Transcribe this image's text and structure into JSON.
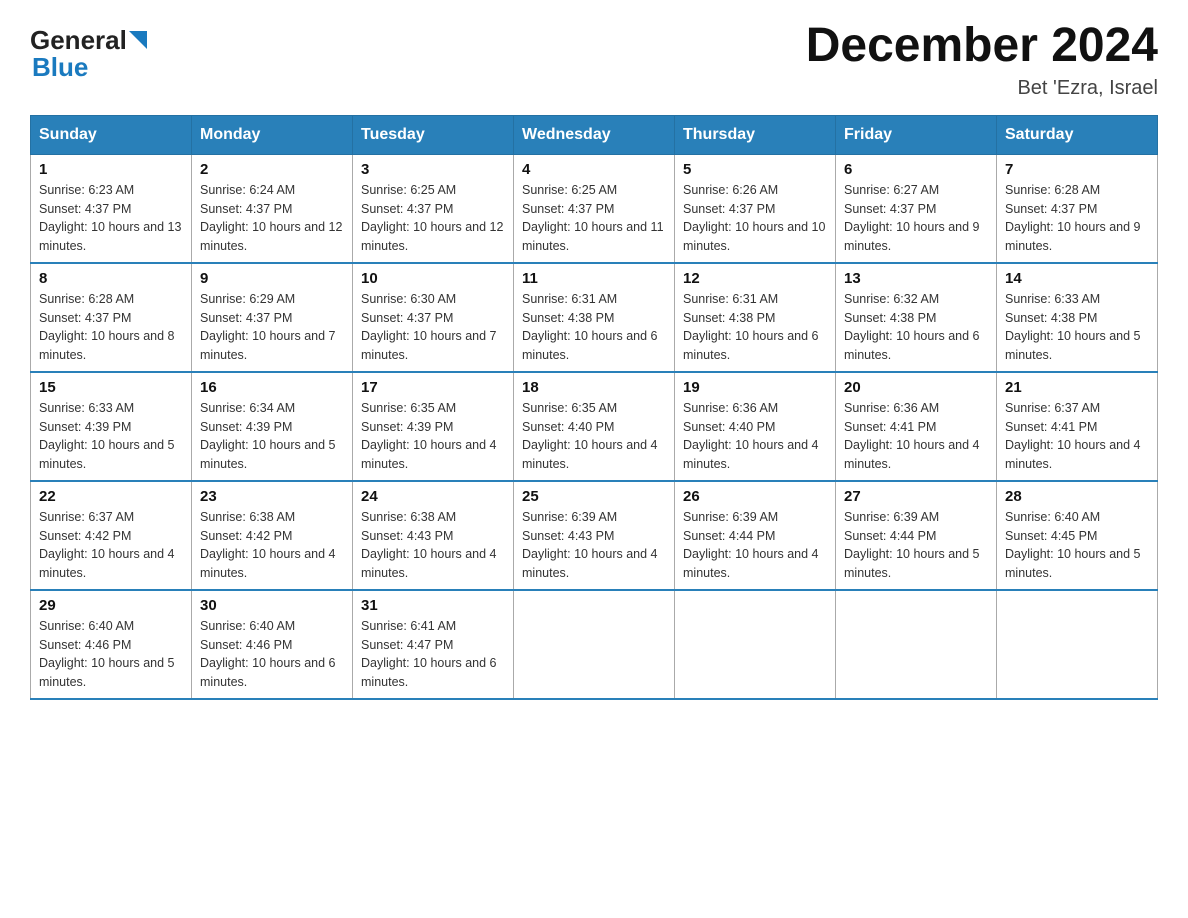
{
  "header": {
    "logo_general": "General",
    "logo_blue": "Blue",
    "title": "December 2024",
    "location": "Bet 'Ezra, Israel"
  },
  "days_of_week": [
    "Sunday",
    "Monday",
    "Tuesday",
    "Wednesday",
    "Thursday",
    "Friday",
    "Saturday"
  ],
  "weeks": [
    [
      {
        "day": "1",
        "sunrise": "6:23 AM",
        "sunset": "4:37 PM",
        "daylight": "10 hours and 13 minutes."
      },
      {
        "day": "2",
        "sunrise": "6:24 AM",
        "sunset": "4:37 PM",
        "daylight": "10 hours and 12 minutes."
      },
      {
        "day": "3",
        "sunrise": "6:25 AM",
        "sunset": "4:37 PM",
        "daylight": "10 hours and 12 minutes."
      },
      {
        "day": "4",
        "sunrise": "6:25 AM",
        "sunset": "4:37 PM",
        "daylight": "10 hours and 11 minutes."
      },
      {
        "day": "5",
        "sunrise": "6:26 AM",
        "sunset": "4:37 PM",
        "daylight": "10 hours and 10 minutes."
      },
      {
        "day": "6",
        "sunrise": "6:27 AM",
        "sunset": "4:37 PM",
        "daylight": "10 hours and 9 minutes."
      },
      {
        "day": "7",
        "sunrise": "6:28 AM",
        "sunset": "4:37 PM",
        "daylight": "10 hours and 9 minutes."
      }
    ],
    [
      {
        "day": "8",
        "sunrise": "6:28 AM",
        "sunset": "4:37 PM",
        "daylight": "10 hours and 8 minutes."
      },
      {
        "day": "9",
        "sunrise": "6:29 AM",
        "sunset": "4:37 PM",
        "daylight": "10 hours and 7 minutes."
      },
      {
        "day": "10",
        "sunrise": "6:30 AM",
        "sunset": "4:37 PM",
        "daylight": "10 hours and 7 minutes."
      },
      {
        "day": "11",
        "sunrise": "6:31 AM",
        "sunset": "4:38 PM",
        "daylight": "10 hours and 6 minutes."
      },
      {
        "day": "12",
        "sunrise": "6:31 AM",
        "sunset": "4:38 PM",
        "daylight": "10 hours and 6 minutes."
      },
      {
        "day": "13",
        "sunrise": "6:32 AM",
        "sunset": "4:38 PM",
        "daylight": "10 hours and 6 minutes."
      },
      {
        "day": "14",
        "sunrise": "6:33 AM",
        "sunset": "4:38 PM",
        "daylight": "10 hours and 5 minutes."
      }
    ],
    [
      {
        "day": "15",
        "sunrise": "6:33 AM",
        "sunset": "4:39 PM",
        "daylight": "10 hours and 5 minutes."
      },
      {
        "day": "16",
        "sunrise": "6:34 AM",
        "sunset": "4:39 PM",
        "daylight": "10 hours and 5 minutes."
      },
      {
        "day": "17",
        "sunrise": "6:35 AM",
        "sunset": "4:39 PM",
        "daylight": "10 hours and 4 minutes."
      },
      {
        "day": "18",
        "sunrise": "6:35 AM",
        "sunset": "4:40 PM",
        "daylight": "10 hours and 4 minutes."
      },
      {
        "day": "19",
        "sunrise": "6:36 AM",
        "sunset": "4:40 PM",
        "daylight": "10 hours and 4 minutes."
      },
      {
        "day": "20",
        "sunrise": "6:36 AM",
        "sunset": "4:41 PM",
        "daylight": "10 hours and 4 minutes."
      },
      {
        "day": "21",
        "sunrise": "6:37 AM",
        "sunset": "4:41 PM",
        "daylight": "10 hours and 4 minutes."
      }
    ],
    [
      {
        "day": "22",
        "sunrise": "6:37 AM",
        "sunset": "4:42 PM",
        "daylight": "10 hours and 4 minutes."
      },
      {
        "day": "23",
        "sunrise": "6:38 AM",
        "sunset": "4:42 PM",
        "daylight": "10 hours and 4 minutes."
      },
      {
        "day": "24",
        "sunrise": "6:38 AM",
        "sunset": "4:43 PM",
        "daylight": "10 hours and 4 minutes."
      },
      {
        "day": "25",
        "sunrise": "6:39 AM",
        "sunset": "4:43 PM",
        "daylight": "10 hours and 4 minutes."
      },
      {
        "day": "26",
        "sunrise": "6:39 AM",
        "sunset": "4:44 PM",
        "daylight": "10 hours and 4 minutes."
      },
      {
        "day": "27",
        "sunrise": "6:39 AM",
        "sunset": "4:44 PM",
        "daylight": "10 hours and 5 minutes."
      },
      {
        "day": "28",
        "sunrise": "6:40 AM",
        "sunset": "4:45 PM",
        "daylight": "10 hours and 5 minutes."
      }
    ],
    [
      {
        "day": "29",
        "sunrise": "6:40 AM",
        "sunset": "4:46 PM",
        "daylight": "10 hours and 5 minutes."
      },
      {
        "day": "30",
        "sunrise": "6:40 AM",
        "sunset": "4:46 PM",
        "daylight": "10 hours and 6 minutes."
      },
      {
        "day": "31",
        "sunrise": "6:41 AM",
        "sunset": "4:47 PM",
        "daylight": "10 hours and 6 minutes."
      },
      null,
      null,
      null,
      null
    ]
  ]
}
